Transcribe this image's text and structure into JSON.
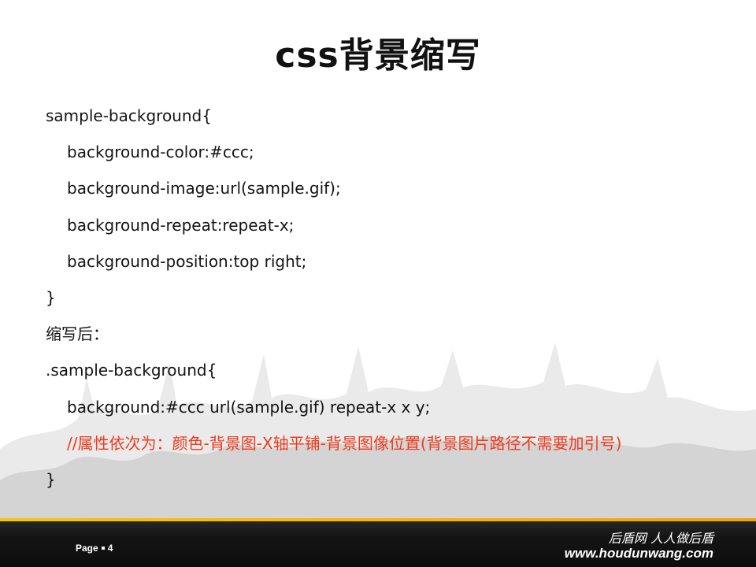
{
  "slide": {
    "title": "css背景缩写",
    "lines": [
      "sample-background{",
      "background-color:#ccc;",
      "background-image:url(sample.gif);",
      "background-repeat:repeat-x;",
      "background-position:top right;",
      "}",
      "缩写后：",
      ".sample-background{",
      "background:#ccc url(sample.gif) repeat-x x y;",
      "//属性依次为：颜色-背景图-X轴平铺-背景图像位置(背景图片路径不需要加引号)",
      "}"
    ]
  },
  "footer": {
    "page_word": "Page",
    "page_number": "4",
    "brand_cn": "后盾网 人人做后盾",
    "brand_url": "www.houdunwang.com"
  },
  "colors": {
    "text": "#141414",
    "comment": "#ee3b1c",
    "footer_bg": "#111111",
    "footer_band": "#f6c700"
  }
}
